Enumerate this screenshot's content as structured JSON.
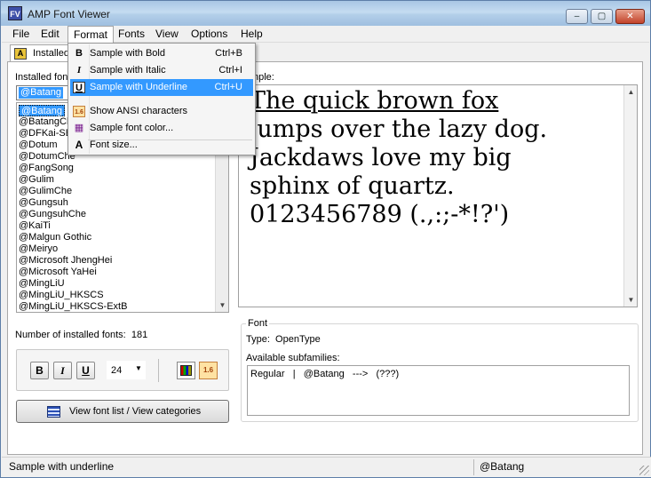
{
  "window": {
    "title": "AMP Font Viewer",
    "icon": "app-icon"
  },
  "menubar": {
    "items": [
      "File",
      "Edit",
      "Format",
      "Fonts",
      "View",
      "Options",
      "Help"
    ],
    "active": "Format"
  },
  "format_menu": {
    "items": [
      {
        "label": "Sample with Bold",
        "shortcut": "Ctrl+B",
        "icon": "bold-icon",
        "glyph": "B"
      },
      {
        "label": "Sample with Italic",
        "shortcut": "Ctrl+I",
        "icon": "italic-icon",
        "glyph": "I"
      },
      {
        "label": "Sample with Underline",
        "shortcut": "Ctrl+U",
        "icon": "underline-icon",
        "glyph": "U",
        "highlighted": true
      },
      {
        "label": "Show ANSI characters",
        "shortcut": "",
        "icon": "ansi-icon",
        "glyph": "1.6"
      },
      {
        "label": "Sample font color...",
        "shortcut": "",
        "icon": "color-grid-icon",
        "glyph": "▦"
      },
      {
        "label": "Font size...",
        "shortcut": "",
        "icon": "font-size-icon",
        "glyph": "A"
      }
    ]
  },
  "tab": {
    "label": "Installed"
  },
  "left_panel": {
    "label": "Installed fon",
    "selected_font": "@Batang",
    "fonts": [
      "@Batang",
      "@BatangCh",
      "@DFKai-SB",
      "@Dotum",
      "@DotumChe",
      "@FangSong",
      "@Gulim",
      "@GulimChe",
      "@Gungsuh",
      "@GungsuhChe",
      "@KaiTi",
      "@Malgun Gothic",
      "@Meiryo",
      "@Microsoft JhengHei",
      "@Microsoft YaHei",
      "@MingLiU",
      "@MingLiU_HKSCS",
      "@MingLiU_HKSCS-ExtB"
    ],
    "count_label": "Number of installed fonts:",
    "count_value": "181",
    "toolbar": {
      "bold": "B",
      "italic": "I",
      "underline": "U",
      "size": "24",
      "ansi": "1.6"
    },
    "view_button": "View font list / View categories"
  },
  "right_panel": {
    "sample_label": "nple:",
    "sample_lines": [
      "The quick brown fox",
      "jumps over the lazy dog.",
      "Jackdaws love my big",
      "sphinx of quartz.",
      "0123456789 (.,:;-*!?')"
    ],
    "font_group": {
      "title": "Font",
      "type_label": "Type:",
      "type_value": "OpenType",
      "available_label": "Available subfamilies:",
      "subfamilies": "Regular   |   @Batang   --->   (???)"
    }
  },
  "statusbar": {
    "left": "Sample with underline",
    "right": "@Batang"
  }
}
